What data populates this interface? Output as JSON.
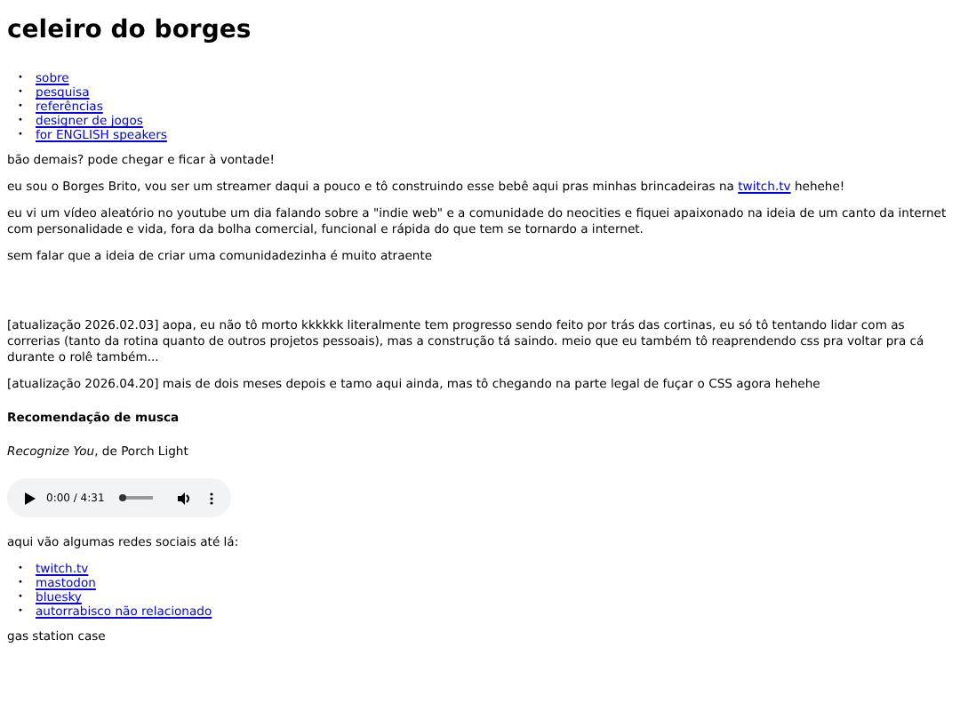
{
  "title": "celeiro do borges",
  "nav": [
    {
      "marker": "•",
      "text": "sobre"
    },
    {
      "marker": "•",
      "text": "pesquisa"
    },
    {
      "marker": "•",
      "text": "referências"
    },
    {
      "marker": "•",
      "text": "designer de jogos"
    },
    {
      "marker": "•",
      "text": "for ENGLISH speakers"
    }
  ],
  "paragraphs": [
    {
      "parts": [
        {
          "kind": "text",
          "text": "bão demais? pode chegar e ficar à vontade!"
        }
      ]
    },
    {
      "parts": [
        {
          "kind": "text",
          "text": "eu sou o Borges Brito, vou ser um streamer daqui a pouco e tô construindo esse bebê aqui pras minhas brincadeiras na "
        },
        {
          "kind": "link",
          "text": "twitch.tv"
        },
        {
          "kind": "text",
          "text": " hehehe!"
        }
      ]
    },
    {
      "parts": [
        {
          "kind": "text",
          "text": "eu vi um vídeo aleatório no youtube um dia falando sobre a \"indie web\" e a comunidade do neocities e fiquei apaixonado na ideia de um canto da internet com personalidade e vida, fora da bolha comercial, funcional e rápida do que tem se tornardo a internet."
        }
      ]
    },
    {
      "parts": [
        {
          "kind": "text",
          "text": "sem falar que a ideia de criar uma comunidadezinha é muito atraente"
        }
      ]
    }
  ],
  "updates": [
    "[atualização 2026.02.03] aopa, eu não tô morto kkkkkk literalmente tem progresso sendo feito por trás das cortinas, eu só tô tentando lidar com as correrias (tanto da rotina quanto de outros projetos pessoais), mas a construção tá saindo. meio que eu também tô reaprendendo css pra voltar pra cá durante o rolê também...",
    "[atualização 2026.04.20] mais de dois meses depois e tamo aqui ainda, mas tô chegando na parte legal de fuçar o CSS agora hehehe"
  ],
  "music": {
    "heading": "Recomendação de musca",
    "song": "*Recognize You*, de Porch Light",
    "player": {
      "time": "0:00 / 4:31",
      "level": 0
    }
  },
  "social_intro": "aqui vão algumas redes sociais até lá:",
  "social_links": [
    {
      "marker": "•",
      "text": "twitch.tv"
    },
    {
      "marker": "•",
      "text": "mastodon"
    },
    {
      "marker": "•",
      "text": "bluesky"
    },
    {
      "marker": "•",
      "text": "autorrabisco não relacionado"
    }
  ],
  "footer": "gas station case"
}
